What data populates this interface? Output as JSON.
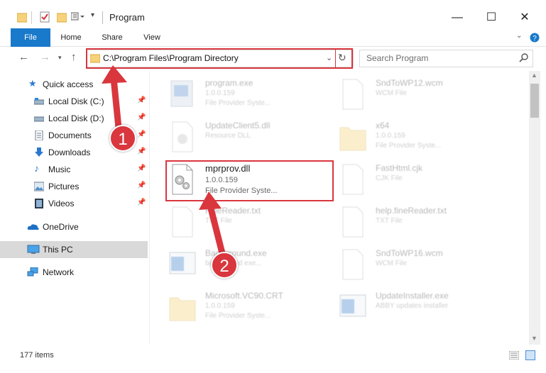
{
  "window": {
    "title": "Program",
    "minimize": "—",
    "maximize": "☐",
    "close": "✕"
  },
  "ribbon": {
    "tabs": [
      "File",
      "Home",
      "Share",
      "View"
    ],
    "expand_icon": "chevron-down-icon",
    "help_icon": "help-icon"
  },
  "address": {
    "path": "C:\\Program Files\\Program Directory"
  },
  "search": {
    "placeholder": "Search Program"
  },
  "sidebar": {
    "items": [
      {
        "label": "Quick access",
        "icon": "star-icon",
        "pinned": false
      },
      {
        "label": "Local Disk (C:)",
        "icon": "drive-icon",
        "pinned": true
      },
      {
        "label": "Local Disk (D:)",
        "icon": "drive-icon",
        "pinned": true
      },
      {
        "label": "Documents",
        "icon": "documents-icon",
        "pinned": true
      },
      {
        "label": "Downloads",
        "icon": "download-icon",
        "pinned": true
      },
      {
        "label": "Music",
        "icon": "music-icon",
        "pinned": true
      },
      {
        "label": "Pictures",
        "icon": "pictures-icon",
        "pinned": true
      },
      {
        "label": "Videos",
        "icon": "videos-icon",
        "pinned": true
      },
      {
        "label": "OneDrive",
        "icon": "cloud-icon",
        "pinned": false
      },
      {
        "label": "This PC",
        "icon": "computer-icon",
        "pinned": false,
        "selected": true
      },
      {
        "label": "Network",
        "icon": "network-icon",
        "pinned": false
      }
    ]
  },
  "files": [
    {
      "name": "program.exe",
      "version": "1.0.0.159",
      "desc": "File Provider Syste...",
      "icon": "exe-icon"
    },
    {
      "name": "SndToWP12.wcm",
      "version": "",
      "desc": "WCM File",
      "icon": "blank-file-icon"
    },
    {
      "name": "UpdateClient5.dll",
      "version": "",
      "desc": "Resource DLL",
      "icon": "dll-icon"
    },
    {
      "name": "x64",
      "version": "1.0.0.159",
      "desc": "File Provider Syste...",
      "icon": "folder-icon"
    },
    {
      "name": "mprprov.dll",
      "version": "1.0.0.159",
      "desc": "File Provider Syste...",
      "icon": "dll-gear-icon",
      "highlighted": true
    },
    {
      "name": "FastHtml.cjk",
      "version": "",
      "desc": "CJK File",
      "icon": "blank-file-icon"
    },
    {
      "name": "FineReader.txt",
      "version": "",
      "desc": "TXT File",
      "icon": "blank-file-icon"
    },
    {
      "name": "help.fineReader.txt",
      "version": "",
      "desc": "TXT File",
      "icon": "blank-file-icon"
    },
    {
      "name": "Background.exe",
      "version": "",
      "desc": "background exe...",
      "icon": "window-icon"
    },
    {
      "name": "SndToWP16.wcm",
      "version": "",
      "desc": "WCM File",
      "icon": "blank-file-icon"
    },
    {
      "name": "Microsoft.VC90.CRT",
      "version": "1.0.0.159",
      "desc": "File Provider Syste...",
      "icon": "folder-icon"
    },
    {
      "name": "UpdateInstaller.exe",
      "version": "",
      "desc": "ABBY updates installer",
      "icon": "window-icon"
    }
  ],
  "status": {
    "count": "177 items"
  },
  "annotations": {
    "badge1": "1",
    "badge2": "2"
  },
  "colors": {
    "accent": "#1979ca",
    "highlight": "#d9363e",
    "selected": "#d9d9d9"
  }
}
